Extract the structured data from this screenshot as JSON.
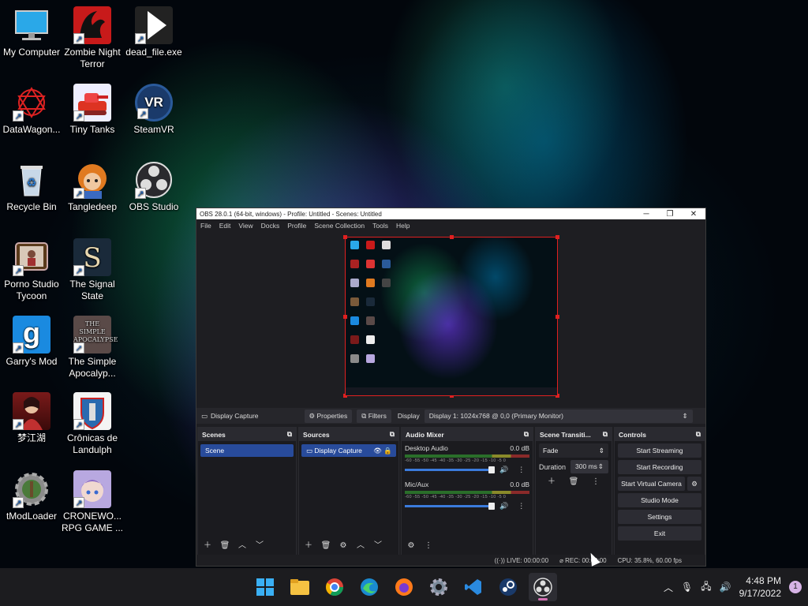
{
  "desktop": {
    "icons": [
      {
        "label": "My Computer",
        "icon": "monitor-icon"
      },
      {
        "label": "Zombie Night Terror",
        "icon": "zombie-game-icon"
      },
      {
        "label": "dead_file.exe",
        "icon": "play-file-icon"
      },
      {
        "label": "DataWagon...",
        "icon": "datawagon-icon"
      },
      {
        "label": "Tiny Tanks",
        "icon": "tiny-tanks-icon"
      },
      {
        "label": "SteamVR",
        "icon": "steamvr-icon"
      },
      {
        "label": "Recycle Bin",
        "icon": "recycle-bin-icon"
      },
      {
        "label": "Tangledeep",
        "icon": "tangledeep-icon"
      },
      {
        "label": "OBS Studio",
        "icon": "obs-icon"
      },
      {
        "label": "Porno Studio Tycoon",
        "icon": "tv-game-icon"
      },
      {
        "label": "The Signal State",
        "icon": "signal-state-icon"
      },
      {
        "label": "Garry's Mod",
        "icon": "garrys-mod-icon"
      },
      {
        "label": "The Simple Apocalyp...",
        "icon": "simple-apocalypse-icon"
      },
      {
        "label": "梦江湖",
        "icon": "meng-jianghu-icon"
      },
      {
        "label": "Crônicas de Landulph",
        "icon": "landulph-icon"
      },
      {
        "label": "tModLoader",
        "icon": "tmodloader-icon"
      },
      {
        "label": "CRONEWO... RPG GAME ...",
        "icon": "cronewo-icon"
      }
    ],
    "vr_text": "VR",
    "garrys_text": "g",
    "apocalypse_text": "THE SIMPLE APOCALYPSE"
  },
  "obs": {
    "title": "OBS 28.0.1 (64-bit, windows) - Profile: Untitled - Scenes: Untitled",
    "menu": [
      "File",
      "Edit",
      "View",
      "Docks",
      "Profile",
      "Scene Collection",
      "Tools",
      "Help"
    ],
    "sourcebar": {
      "source_name": "Display Capture",
      "properties": "Properties",
      "filters": "Filters",
      "display_label": "Display",
      "display_value": "Display 1: 1024x768 @ 0,0 (Primary Monitor)"
    },
    "scenes": {
      "title": "Scenes",
      "items": [
        "Scene"
      ]
    },
    "sources": {
      "title": "Sources",
      "items": [
        "Display Capture"
      ]
    },
    "mixer": {
      "title": "Audio Mixer",
      "scale": "-60 -55 -50 -45 -40 -35 -30 -25 -20 -15 -10 -5 0",
      "channels": [
        {
          "name": "Desktop Audio",
          "level": "0.0 dB"
        },
        {
          "name": "Mic/Aux",
          "level": "0.0 dB"
        }
      ]
    },
    "transitions": {
      "title": "Scene Transiti...",
      "type": "Fade",
      "duration_label": "Duration",
      "duration": "300 ms"
    },
    "controls": {
      "title": "Controls",
      "start_streaming": "Start Streaming",
      "start_recording": "Start Recording",
      "virtual_camera": "Start Virtual Camera",
      "studio_mode": "Studio Mode",
      "settings": "Settings",
      "exit": "Exit"
    },
    "status": {
      "live": "LIVE: 00:00:00",
      "rec": "REC: 00:00:00",
      "cpu": "CPU: 35.8%, 60.00 fps"
    }
  },
  "taskbar": {
    "apps": [
      "windows-start-icon",
      "file-explorer-icon",
      "chrome-icon",
      "edge-icon",
      "firefox-icon",
      "settings-icon",
      "vscode-icon",
      "steam-icon",
      "obs-taskbar-icon"
    ],
    "time": "4:48 PM",
    "date": "9/17/2022",
    "notifications": "1"
  }
}
